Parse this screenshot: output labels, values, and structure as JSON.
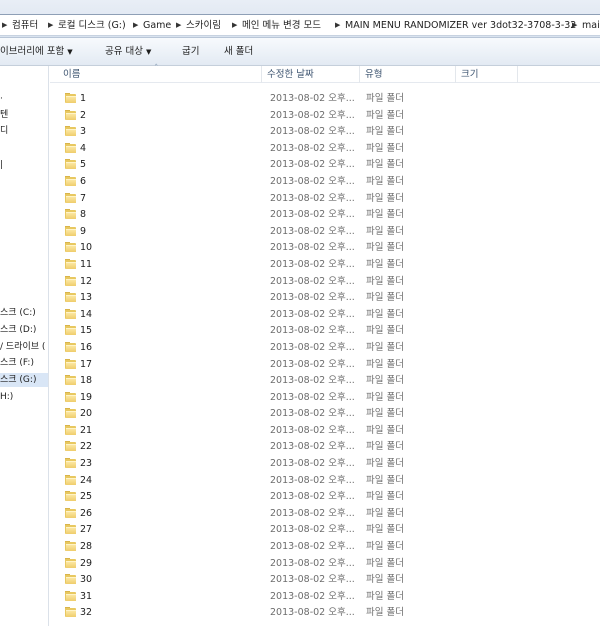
{
  "breadcrumbs": [
    "컴퓨터",
    "로컬 디스크 (G:)",
    "Game",
    "스카이림",
    "메인 메뉴 변경 모드",
    "MAIN MENU RANDOMIZER ver 3dot32-3708-3-32",
    "mai"
  ],
  "toolbar": {
    "library_label": "이브러리에 포함",
    "share_label": "공유 대상",
    "burn_label": "굽기",
    "new_folder_label": "새 폴더"
  },
  "nav": {
    "items": [
      {
        "label": "·"
      },
      {
        "label": "텐"
      },
      {
        "label": "디"
      },
      {
        "label": "|"
      },
      {
        "label": "스크 (C:)"
      },
      {
        "label": "스크 (D:)"
      },
      {
        "label": "/ 드라이브 ("
      },
      {
        "label": "스크 (F:)"
      },
      {
        "label": "스크 (G:)"
      },
      {
        "label": "H:)"
      }
    ]
  },
  "columns": {
    "name": "이름",
    "date": "수정한 날짜",
    "type": "유형",
    "size": "크기"
  },
  "files": [
    {
      "name": "1",
      "date": "2013-08-02 오후...",
      "type": "파일 폴더"
    },
    {
      "name": "2",
      "date": "2013-08-02 오후...",
      "type": "파일 폴더"
    },
    {
      "name": "3",
      "date": "2013-08-02 오후...",
      "type": "파일 폴더"
    },
    {
      "name": "4",
      "date": "2013-08-02 오후...",
      "type": "파일 폴더"
    },
    {
      "name": "5",
      "date": "2013-08-02 오후...",
      "type": "파일 폴더"
    },
    {
      "name": "6",
      "date": "2013-08-02 오후...",
      "type": "파일 폴더"
    },
    {
      "name": "7",
      "date": "2013-08-02 오후...",
      "type": "파일 폴더"
    },
    {
      "name": "8",
      "date": "2013-08-02 오후...",
      "type": "파일 폴더"
    },
    {
      "name": "9",
      "date": "2013-08-02 오후...",
      "type": "파일 폴더"
    },
    {
      "name": "10",
      "date": "2013-08-02 오후...",
      "type": "파일 폴더"
    },
    {
      "name": "11",
      "date": "2013-08-02 오후...",
      "type": "파일 폴더"
    },
    {
      "name": "12",
      "date": "2013-08-02 오후...",
      "type": "파일 폴더"
    },
    {
      "name": "13",
      "date": "2013-08-02 오후...",
      "type": "파일 폴더"
    },
    {
      "name": "14",
      "date": "2013-08-02 오후...",
      "type": "파일 폴더"
    },
    {
      "name": "15",
      "date": "2013-08-02 오후...",
      "type": "파일 폴더"
    },
    {
      "name": "16",
      "date": "2013-08-02 오후...",
      "type": "파일 폴더"
    },
    {
      "name": "17",
      "date": "2013-08-02 오후...",
      "type": "파일 폴더"
    },
    {
      "name": "18",
      "date": "2013-08-02 오후...",
      "type": "파일 폴더"
    },
    {
      "name": "19",
      "date": "2013-08-02 오후...",
      "type": "파일 폴더"
    },
    {
      "name": "20",
      "date": "2013-08-02 오후...",
      "type": "파일 폴더"
    },
    {
      "name": "21",
      "date": "2013-08-02 오후...",
      "type": "파일 폴더"
    },
    {
      "name": "22",
      "date": "2013-08-02 오후...",
      "type": "파일 폴더"
    },
    {
      "name": "23",
      "date": "2013-08-02 오후...",
      "type": "파일 폴더"
    },
    {
      "name": "24",
      "date": "2013-08-02 오후...",
      "type": "파일 폴더"
    },
    {
      "name": "25",
      "date": "2013-08-02 오후...",
      "type": "파일 폴더"
    },
    {
      "name": "26",
      "date": "2013-08-02 오후...",
      "type": "파일 폴더"
    },
    {
      "name": "27",
      "date": "2013-08-02 오후...",
      "type": "파일 폴더"
    },
    {
      "name": "28",
      "date": "2013-08-02 오후...",
      "type": "파일 폴더"
    },
    {
      "name": "29",
      "date": "2013-08-02 오후...",
      "type": "파일 폴더"
    },
    {
      "name": "30",
      "date": "2013-08-02 오후...",
      "type": "파일 폴더"
    },
    {
      "name": "31",
      "date": "2013-08-02 오후...",
      "type": "파일 폴더"
    },
    {
      "name": "32",
      "date": "2013-08-02 오후...",
      "type": "파일 폴더"
    }
  ],
  "icons": {
    "folder": "folder-icon",
    "separator": "chevron-right-icon",
    "dropdown": "caret-down-icon",
    "sort": "sort-up-icon"
  }
}
